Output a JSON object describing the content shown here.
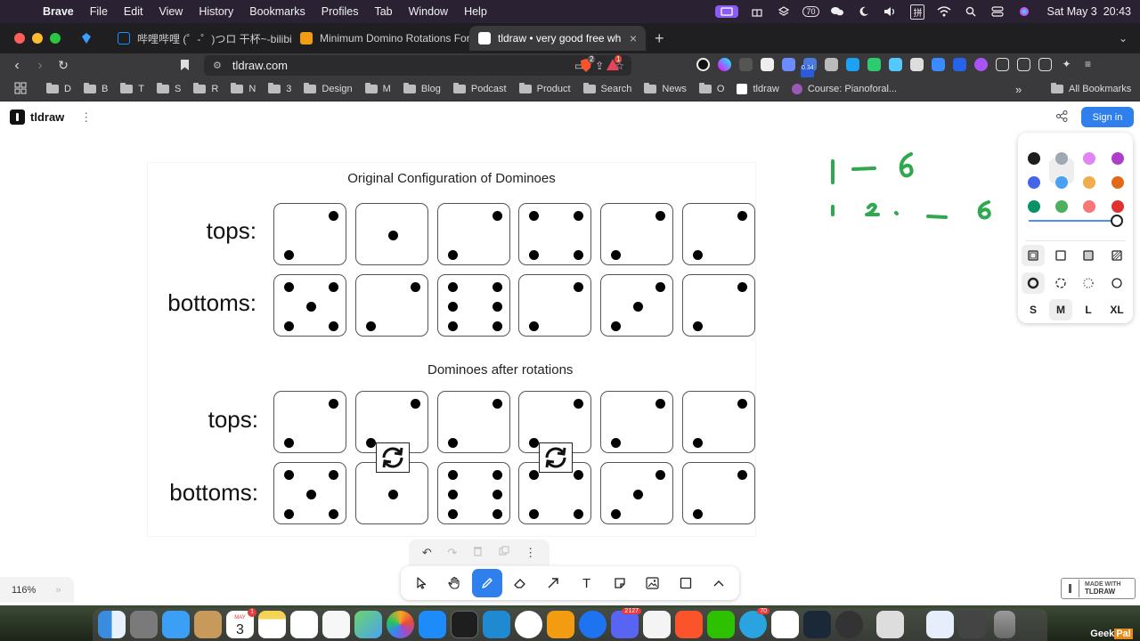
{
  "menubar": {
    "app": "Brave",
    "items": [
      "File",
      "Edit",
      "View",
      "History",
      "Bookmarks",
      "Profiles",
      "Tab",
      "Window",
      "Help"
    ],
    "badge": "70",
    "ime": "拼",
    "clock": "Sat May 3  20:43"
  },
  "tabs": [
    {
      "title": "哔哩哔哩 (゜-゜)つロ 干杯~-bilibili",
      "color": "#1e90ff"
    },
    {
      "title": "Minimum Domino Rotations For E",
      "color": "#f39c12"
    },
    {
      "title": "tldraw • very good free white",
      "color": "#ffffff",
      "active": true
    }
  ],
  "toolbar": {
    "url": "tldraw.com",
    "brave_badge": "2",
    "alert_badge": "1",
    "ext_badge": "0.34"
  },
  "bookmarks": {
    "items": [
      "D",
      "B",
      "T",
      "S",
      "R",
      "N",
      "3",
      "Design",
      "M",
      "Blog",
      "Podcast",
      "Product",
      "Search",
      "News",
      "O"
    ],
    "pinned": [
      "tldraw",
      "Course: Pianoforal..."
    ],
    "overflow": "»",
    "all": "All Bookmarks"
  },
  "app": {
    "brand": "tldraw",
    "menu": "⋮",
    "signin": "Sign in",
    "zoom": "116%",
    "zoom_chevron": "»",
    "made_with": [
      "MADE WITH",
      "TLDRAW"
    ]
  },
  "slide": {
    "title1": "Original Configuration of Dominoes",
    "title2": "Dominoes after rotations",
    "tops_label": "tops:",
    "bottoms_label": "bottoms:",
    "original_tops": [
      2,
      1,
      2,
      4,
      2,
      2
    ],
    "original_bottoms": [
      5,
      2,
      6,
      2,
      3,
      2
    ],
    "rotated_tops": [
      2,
      2,
      2,
      2,
      2,
      2
    ],
    "rotated_bottoms": [
      5,
      1,
      6,
      4,
      3,
      2
    ],
    "rotated_columns": [
      1,
      3
    ]
  },
  "handwriting": {
    "line1": [
      "1",
      "—",
      "6"
    ],
    "line2": [
      "1",
      "2",
      ".",
      "—",
      "6"
    ],
    "color": "#2fa84f"
  },
  "style_panel": {
    "colors": [
      "#1d1d1d",
      "#9fa8b2",
      "#e085f4",
      "#ae3ec9",
      "#4465e9",
      "#4ba1f1",
      "#f1ac4b",
      "#e16919",
      "#099268",
      "#4cb05e",
      "#f87777",
      "#e03131"
    ],
    "selected_color_index": 9,
    "sizes": [
      "S",
      "M",
      "L",
      "XL"
    ],
    "selected_size": "M",
    "opacity": 1.0
  },
  "quick_actions": [
    "undo-icon",
    "redo-icon",
    "trash-icon",
    "duplicate-icon",
    "more-icon"
  ],
  "tools": [
    {
      "name": "select",
      "icon": "cursor-icon"
    },
    {
      "name": "hand",
      "icon": "hand-icon"
    },
    {
      "name": "draw",
      "icon": "pencil-icon",
      "active": true
    },
    {
      "name": "eraser",
      "icon": "eraser-icon"
    },
    {
      "name": "arrow",
      "icon": "arrow-icon"
    },
    {
      "name": "text",
      "icon": "text-icon",
      "glyph": "T"
    },
    {
      "name": "note",
      "icon": "note-icon"
    },
    {
      "name": "asset",
      "icon": "image-icon"
    },
    {
      "name": "rectangle",
      "icon": "rectangle-icon"
    },
    {
      "name": "more",
      "icon": "chevron-up-icon"
    }
  ],
  "dock": {
    "calendar_month": "MAY",
    "calendar_day": "3",
    "calendar_badge": "1",
    "discord_badge": "2127",
    "telegram_badge": "70",
    "watermark": [
      "Geek",
      "Pal"
    ]
  }
}
